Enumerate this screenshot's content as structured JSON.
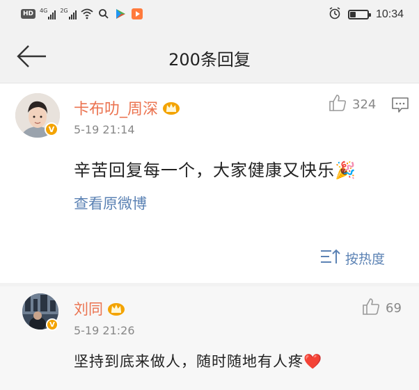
{
  "statusbar": {
    "hd_label": "HD",
    "signal1_label": "4G",
    "signal2_label": "2G",
    "time": "10:34",
    "battery_level": 0.3
  },
  "navbar": {
    "title": "200条回复"
  },
  "post": {
    "username": "卡布叻_周深",
    "timestamp": "5-19 21:14",
    "like_count": "324",
    "content": "辛苦回复每一个，大家健康又快乐🎉",
    "view_original_label": "查看原微博",
    "sort_label": "按热度"
  },
  "reply": {
    "username": "刘同",
    "timestamp": "5-19 21:26",
    "like_count": "69",
    "content": "坚持到底来做人，随时随地有人疼❤️"
  },
  "colors": {
    "username": "#eb7350",
    "link": "#5b82b4",
    "verified_badge": "#f3a300",
    "crown": "#f3a300"
  }
}
